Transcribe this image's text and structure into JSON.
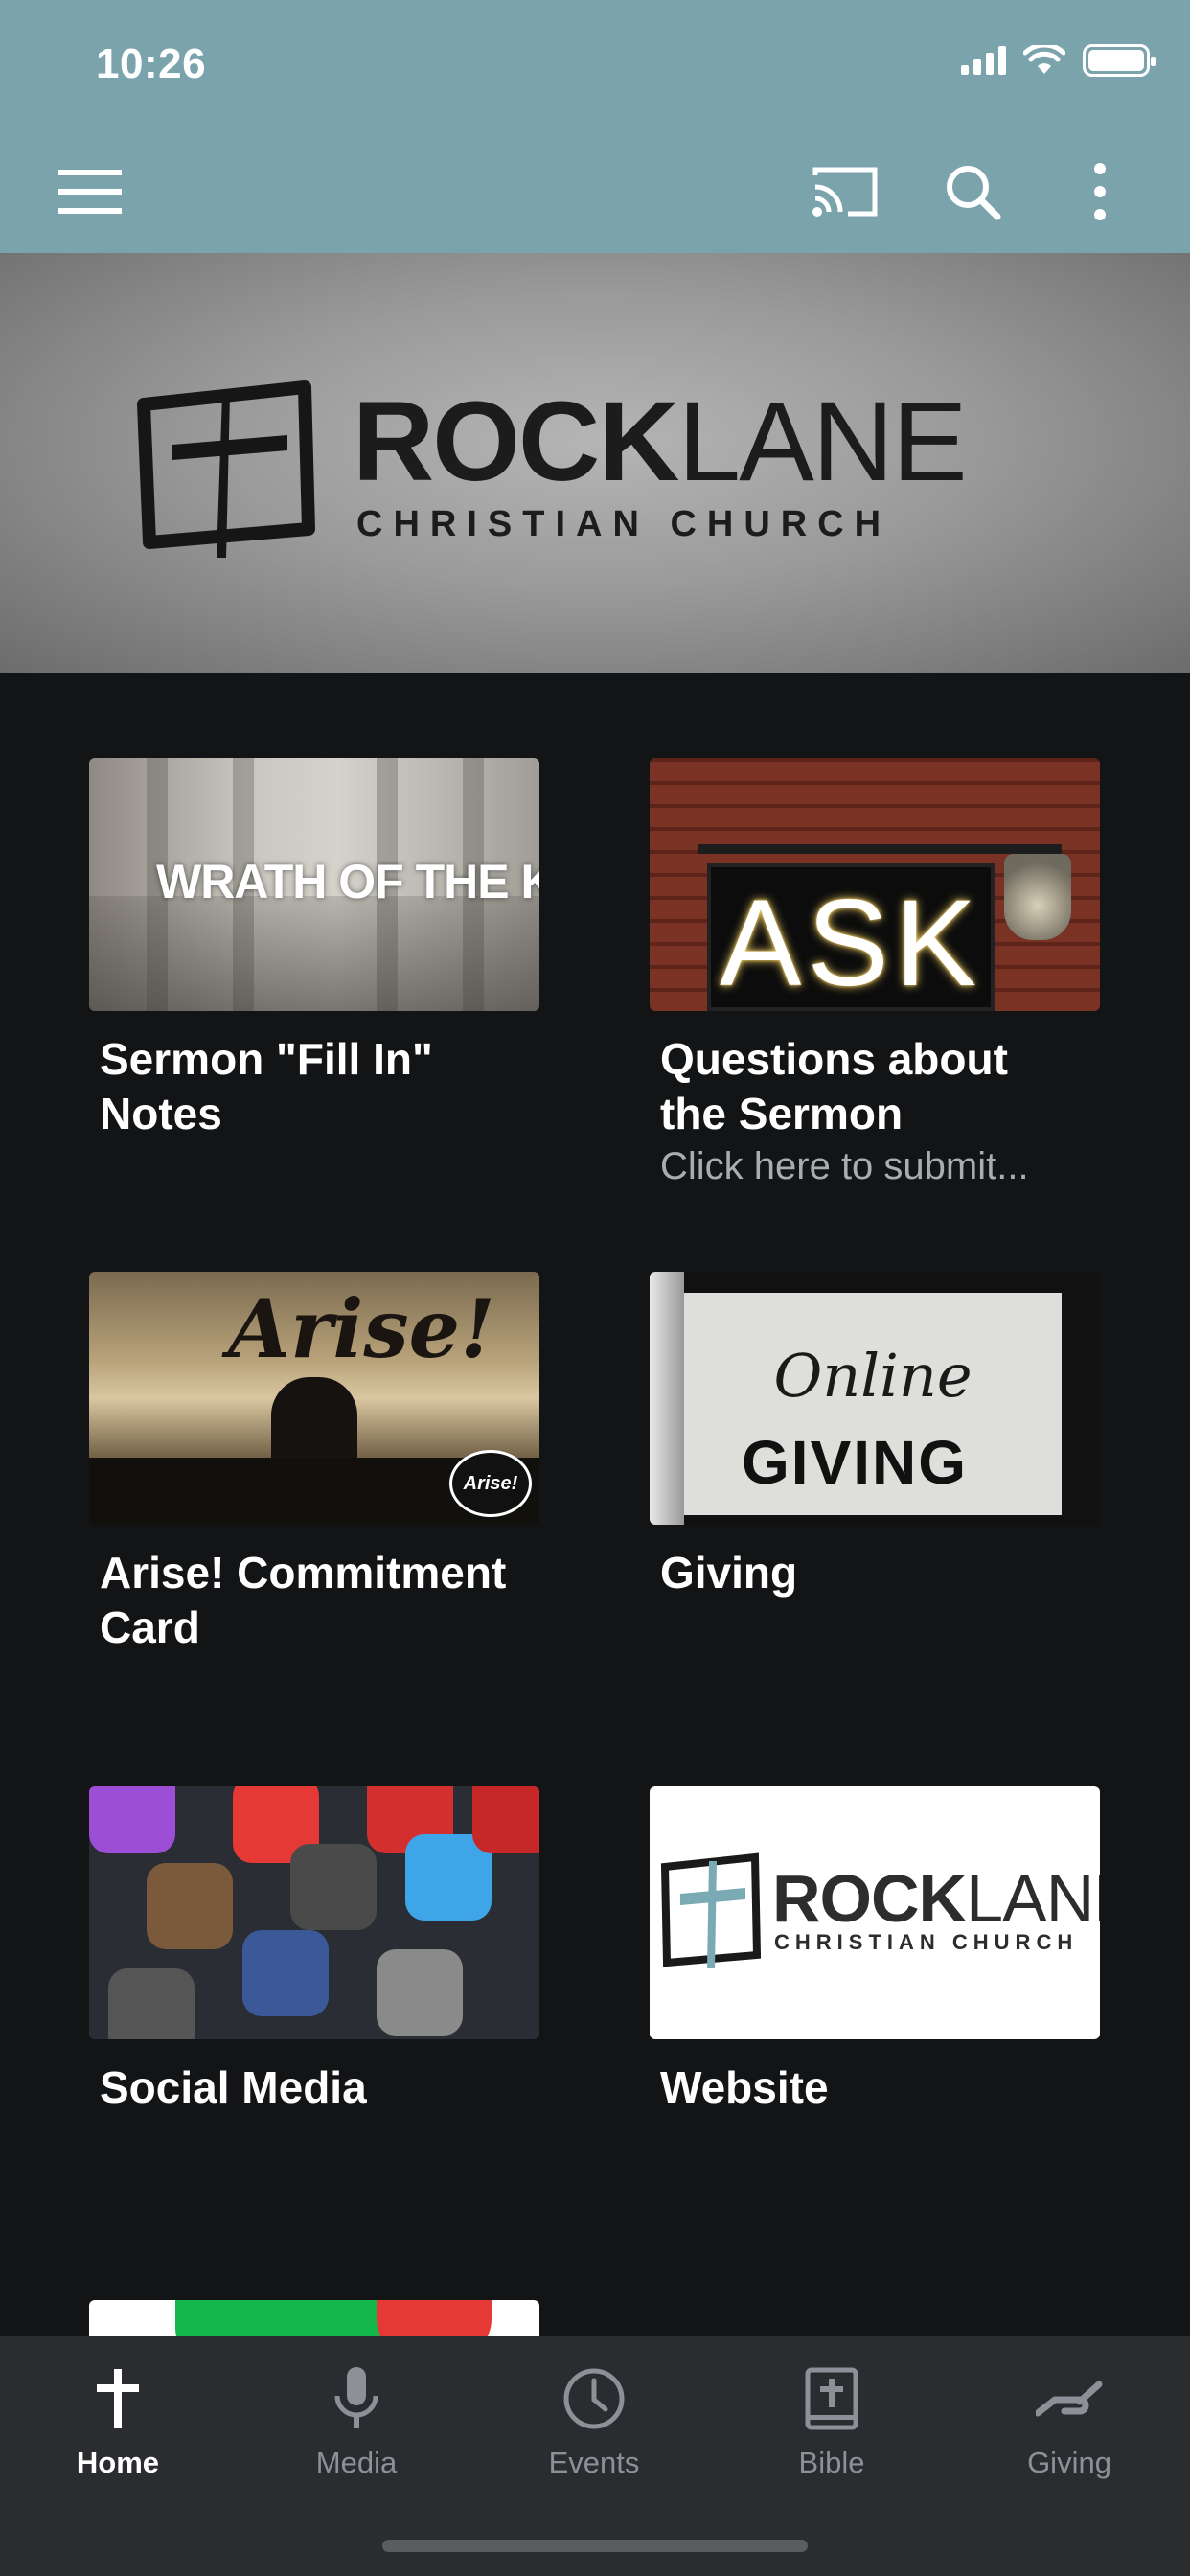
{
  "status_bar": {
    "time": "10:26"
  },
  "banner": {
    "title_bold": "ROCK",
    "title_light": "LANE",
    "subtitle": "CHRISTIAN CHURCH"
  },
  "tiles": [
    {
      "title": "Sermon \"Fill In\" Notes",
      "subtitle": "",
      "image_text": "WRATH OF THE KING"
    },
    {
      "title": "Questions about the Sermon",
      "subtitle": "Click here to submit...",
      "image_text": "ASK"
    },
    {
      "title": "Arise! Commitment Card",
      "subtitle": "",
      "image_text": "Arise!"
    },
    {
      "title": "Giving",
      "subtitle": "",
      "image_text_1": "Online",
      "image_text_2": "GIVING"
    },
    {
      "title": "Social Media",
      "subtitle": ""
    },
    {
      "title": "Website",
      "subtitle": "",
      "image_text_bold": "ROCK",
      "image_text_light": "LANE",
      "image_sub": "CHRISTIAN CHURCH"
    }
  ],
  "bottom_nav": [
    {
      "label": "Home",
      "icon": "cross-icon",
      "active": true
    },
    {
      "label": "Media",
      "icon": "microphone-icon",
      "active": false
    },
    {
      "label": "Events",
      "icon": "clock-icon",
      "active": false
    },
    {
      "label": "Bible",
      "icon": "bible-icon",
      "active": false
    },
    {
      "label": "Giving",
      "icon": "giving-hand-icon",
      "active": false
    }
  ],
  "colors": {
    "app_bar": "#7ba3ac",
    "background": "#131416",
    "nav_bar": "#2a2c30",
    "active_label": "#ffffff",
    "inactive_label": "#8d9096"
  }
}
